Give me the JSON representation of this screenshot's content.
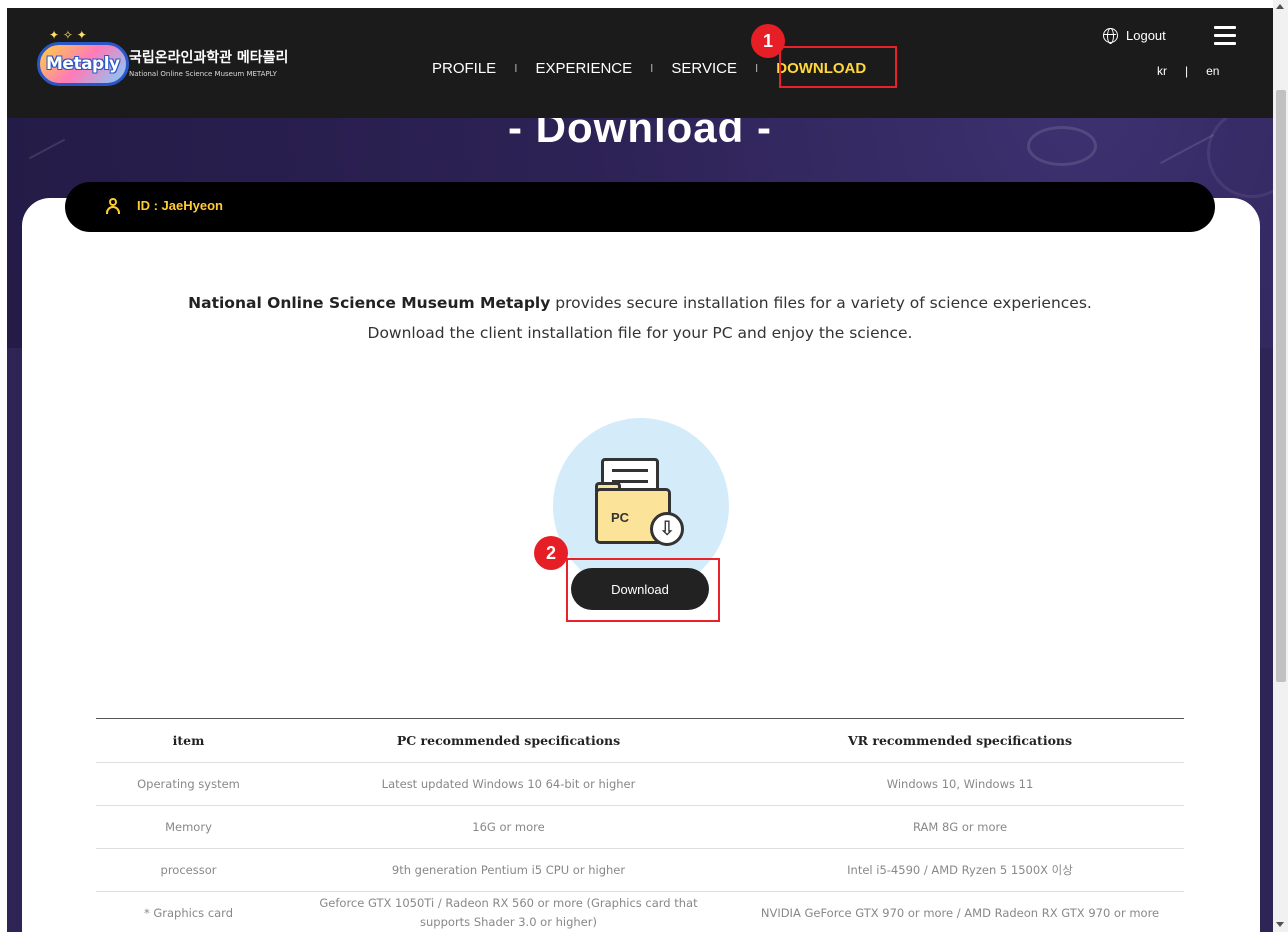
{
  "brand": {
    "badge_text": "Metaply",
    "name_kr": "국립온라인과학관 메타플리",
    "name_en": "National Online Science Museum METAPLY"
  },
  "nav": {
    "items": [
      {
        "label": "PROFILE",
        "active": false
      },
      {
        "label": "EXPERIENCE",
        "active": false
      },
      {
        "label": "SERVICE",
        "active": false
      },
      {
        "label": "DOWNLOAD",
        "active": true
      }
    ],
    "separator": "I"
  },
  "header": {
    "logout_label": "Logout",
    "lang": [
      "kr",
      "en"
    ],
    "lang_separator": "|"
  },
  "annotations": {
    "step1": "1",
    "step2": "2"
  },
  "page_title": "- Download -",
  "user": {
    "id_label": "ID : JaeHyeon"
  },
  "intro": {
    "bold": "National Online Science Museum Metaply",
    "line1_rest": " provides secure installation files for a variety of science experiences.",
    "line2": "Download the client installation file for your PC and enjoy the science."
  },
  "download": {
    "icon_label": "PC",
    "button_label": "Download"
  },
  "specs": {
    "headers": [
      "item",
      "PC recommended specifications",
      "VR recommended specifications"
    ],
    "rows": [
      [
        "Operating system",
        "Latest updated Windows 10 64-bit or higher",
        "Windows 10, Windows 11"
      ],
      [
        "Memory",
        "16G or more",
        "RAM 8G or more"
      ],
      [
        "processor",
        "9th generation Pentium i5 CPU or higher",
        "Intel i5-4590 / AMD Ryzen 5 1500X 이상"
      ],
      [
        "* Graphics card",
        "Geforce GTX 1050Ti / Radeon RX 560 or more (Graphics card that supports Shader 3.0 or higher)",
        "NVIDIA GeForce GTX 970 or more / AMD Radeon RX GTX 970 or more"
      ]
    ]
  },
  "colors": {
    "accent_yellow": "#ffd83b",
    "highlight_red": "#e8212b",
    "hero_purple": "#2f2456"
  }
}
